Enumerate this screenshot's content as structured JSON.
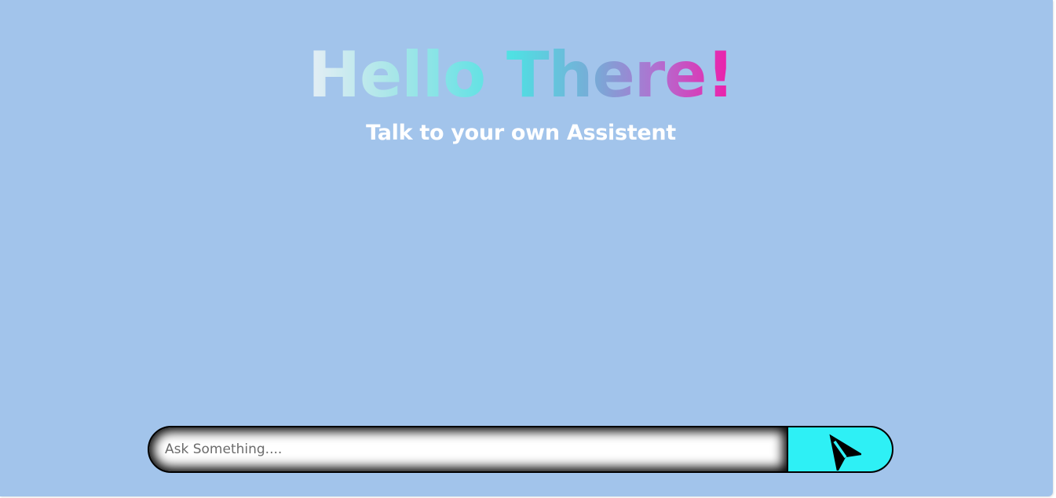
{
  "header": {
    "title": "Hello There!",
    "subtitle": "Talk to your own Assistent"
  },
  "chat": {
    "input_value": "",
    "input_placeholder": "Ask Something....",
    "send_icon": "send-icon"
  },
  "colors": {
    "background": "#a2c4eb",
    "send_button": "#2ef0f5",
    "title_gradient": [
      "#e6eef5",
      "#4fe0e3",
      "#b26fd0",
      "#f01aa8"
    ]
  }
}
